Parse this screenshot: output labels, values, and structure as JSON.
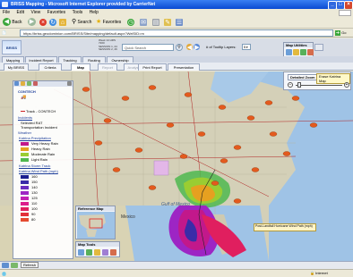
{
  "window": {
    "title": "BRISS Mapping - Microsoft Internet Explorer provided by CarrierNet"
  },
  "menu": [
    "File",
    "Edit",
    "View",
    "Favorites",
    "Tools",
    "Help"
  ],
  "toolbar": {
    "back": "Back",
    "search": "Search",
    "favorites": "Favorites"
  },
  "address": {
    "url": "https://briss.geodominion.com/BRISS/Site/mapping/default.aspx?WelSID=m"
  },
  "go": "Go",
  "app": {
    "logo": "BRISS",
    "search_placeholder": "Quick Search",
    "layers_label": "# of Tooltip Layers:",
    "layers_value": "5",
    "header_info": [
      "Week 14 HRS 7200",
      "SESSION 1, 24",
      "SESSION 2, 26"
    ]
  },
  "nav_tabs": [
    {
      "label": "Mapping",
      "state": "normal"
    },
    {
      "label": "Incident Report",
      "state": "normal"
    },
    {
      "label": "Tracking",
      "state": "normal"
    },
    {
      "label": "Routing",
      "state": "normal"
    },
    {
      "label": "Ownership",
      "state": "normal"
    }
  ],
  "sub_tabs": [
    {
      "label": "My BRISS",
      "state": "normal"
    },
    {
      "label": "Criteria",
      "state": "normal"
    },
    {
      "label": "Map",
      "state": "active"
    },
    {
      "label": "Report",
      "state": "disabled"
    },
    {
      "label": "Analysis",
      "state": "disabled"
    },
    {
      "label": "Print Report",
      "state": "normal"
    },
    {
      "label": "Presentation",
      "state": "normal"
    }
  ],
  "map_utilities": {
    "title": "Map Utilities"
  },
  "zoom": {
    "label": "Detailed Zoom",
    "tooltip": "Erase Katrina Map"
  },
  "legend": {
    "groups": [
      {
        "label": "CONTECH"
      },
      {
        "label": "Track - CONTECH"
      },
      {
        "label": "Incidents"
      },
      {
        "label": "Selected RAT"
      },
      {
        "label": "Transportation Incident"
      },
      {
        "label": "Weather"
      },
      {
        "label": "Katrina Precipitation"
      }
    ],
    "precip": [
      {
        "label": "Very Heavy Rain",
        "color": "#c2188b"
      },
      {
        "label": "Heavy Rain",
        "color": "#e6a020"
      },
      {
        "label": "Moderate Rain",
        "color": "#9acd32"
      },
      {
        "label": "Light Rain",
        "color": "#4fb84f"
      }
    ],
    "storm_track": "Katrina Storm Track",
    "wind_title": "Katrina Wind Path (mph)",
    "wind": [
      {
        "label": "160",
        "color": "#1a1f8f"
      },
      {
        "label": "150",
        "color": "#3a2ca8"
      },
      {
        "label": "140",
        "color": "#6a2dc0"
      },
      {
        "label": "130",
        "color": "#9d25c4"
      },
      {
        "label": "125",
        "color": "#c21fb5"
      },
      {
        "label": "110",
        "color": "#dc1d8c"
      },
      {
        "label": "100",
        "color": "#e01f5f"
      },
      {
        "label": "90",
        "color": "#e2303a"
      },
      {
        "label": "80",
        "color": "#e44a30"
      }
    ]
  },
  "reference_map": {
    "title": "Reference Map"
  },
  "map_tools": {
    "title": "Map Tools"
  },
  "map_labels": {
    "gulf": "Gulf of Mexico",
    "mexico": "Mexico",
    "storm_note": "Post-Landfall Hurricane Wind Path (mph)"
  },
  "bottom": {
    "refresh": "Refresh"
  },
  "status": {
    "zone": "Internet"
  }
}
